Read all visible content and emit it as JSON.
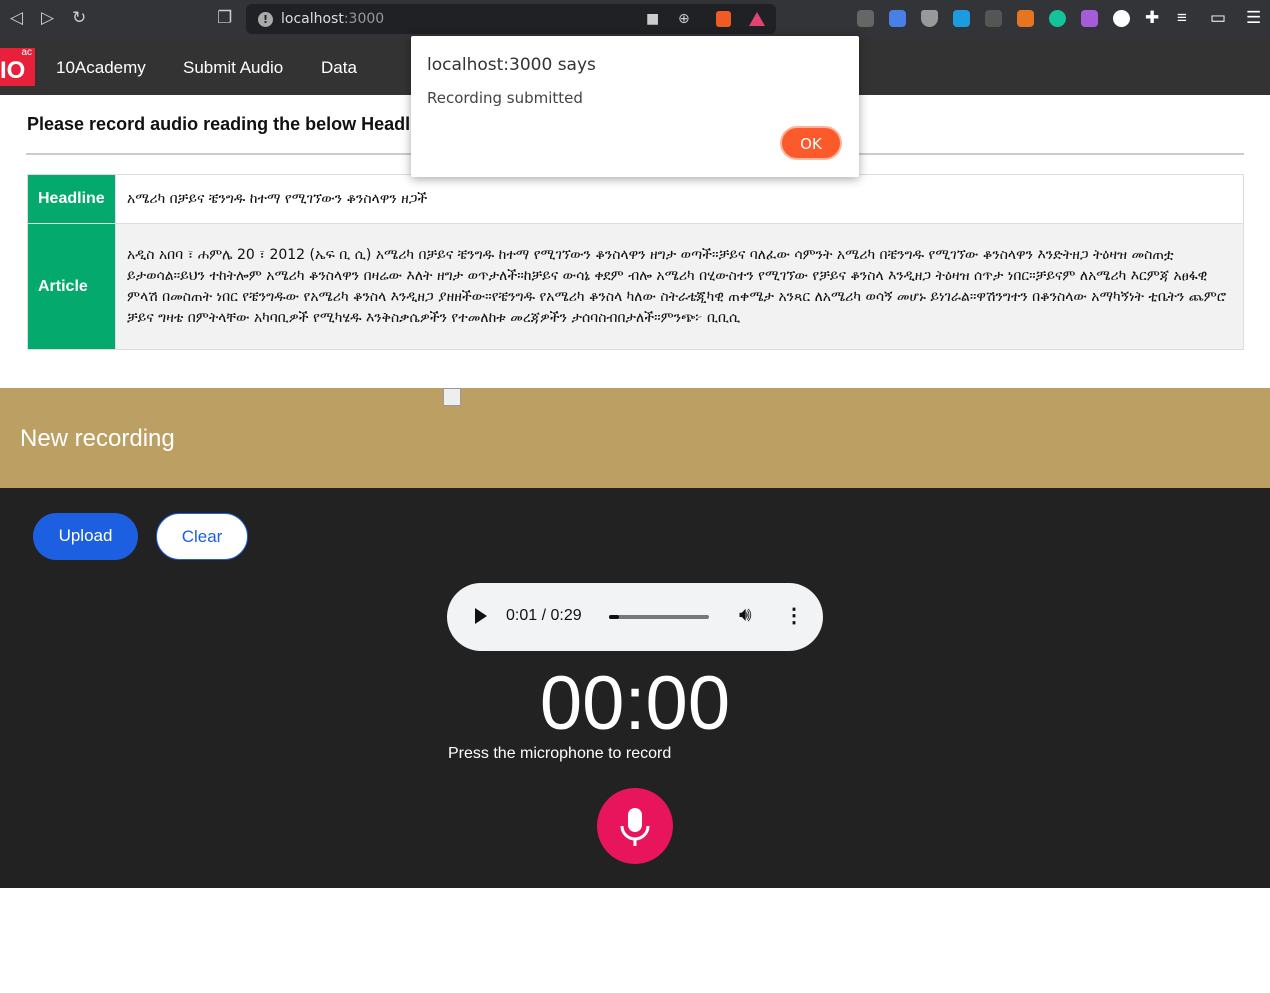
{
  "browser": {
    "url_host": "localhost",
    "url_port": ":3000",
    "extensions": [
      "bookmark-icon",
      "camera-icon",
      "zoom-icon",
      "brave-shield-icon",
      "brave-rewards-icon",
      "tuner-icon",
      "google-translate-icon",
      "shield-icon",
      "folder-icon",
      "c-icon",
      "metamask-icon",
      "grammarly-icon",
      "fox-icon",
      "arc-icon",
      "puzzle-icon",
      "playlist-icon",
      "wallet-icon",
      "menu-icon"
    ]
  },
  "nav": {
    "logo_text": "IO",
    "logo_sup": "ac",
    "items": [
      "10Academy",
      "Submit Audio",
      "Data"
    ]
  },
  "main": {
    "title": "Please record audio reading the below Headline",
    "headline_label": "Headline",
    "headline": "አሜሪካ በቻይና ቼንግዱ ከተማ የሚገኘውን ቆንስላዋን ዘጋች",
    "article_label": "Article",
    "article": "አዲስ አበባ ፣ ሐምሌ 20 ፣ 2012 (ኤፍ ቢ ሲ) አሜሪካ በቻይና ቼንግዱ ከተማ የሚገኘውን ቆንስላዋን ዘግታ ወጣች።ቻይና ባለፈው ሳምንት አሜሪካ በቼንግዱ የሚገኘው ቆንስላዋን እንድትዘጋ ትዕዛዝ መስጠቷ ይታወሳል።ይህን ተከትሎም አሜሪካ ቆንስላዋን በዛሬው እለት ዘግታ ወጥታለች።ከቻይና ውሳኔ ቀደም ብሎ አሜሪካ በሂውስተን የሚገኘው የቻይና ቆንስላ እንዲዘጋ ትዕዛዝ ሰጥታ ነበር።ቻይናም ለአሜሪካ እርምጃ አፀፋዊ ምላሽ በመስጠት ነበር የቼንግዱው የአሜሪካ ቆንስላ እንዲዘጋ ያዘዘችው።የቼንግዱ የአሜሪካ ቆንስላ ካለው ስትራቴጂካዊ ጠቀሜታ አንጻር ለአሜሪካ ወሳኝ መሆኑ ይነገራል።ዋሽንግተን በቆንስላው አማካኝነት ቲቤትን ጨምሮ ቻይና ግዛቴ በምትላቸው አካባቢዎች የሚካሄዱ እንቅስቃሴዎችን የተመለከቱ መረጃዎችን ታሰባስብበታለች።ምንጭ፦ ቢቢሲ"
  },
  "recorder": {
    "header": "New recording",
    "upload_label": "Upload",
    "clear_label": "Clear",
    "player_time": "0:01 / 0:29",
    "player_progress": 0.034,
    "timer": "00:00",
    "hint": "Press the microphone to record"
  },
  "dialog": {
    "title": "localhost:3000 says",
    "message": "Recording submitted",
    "ok_label": "OK"
  }
}
